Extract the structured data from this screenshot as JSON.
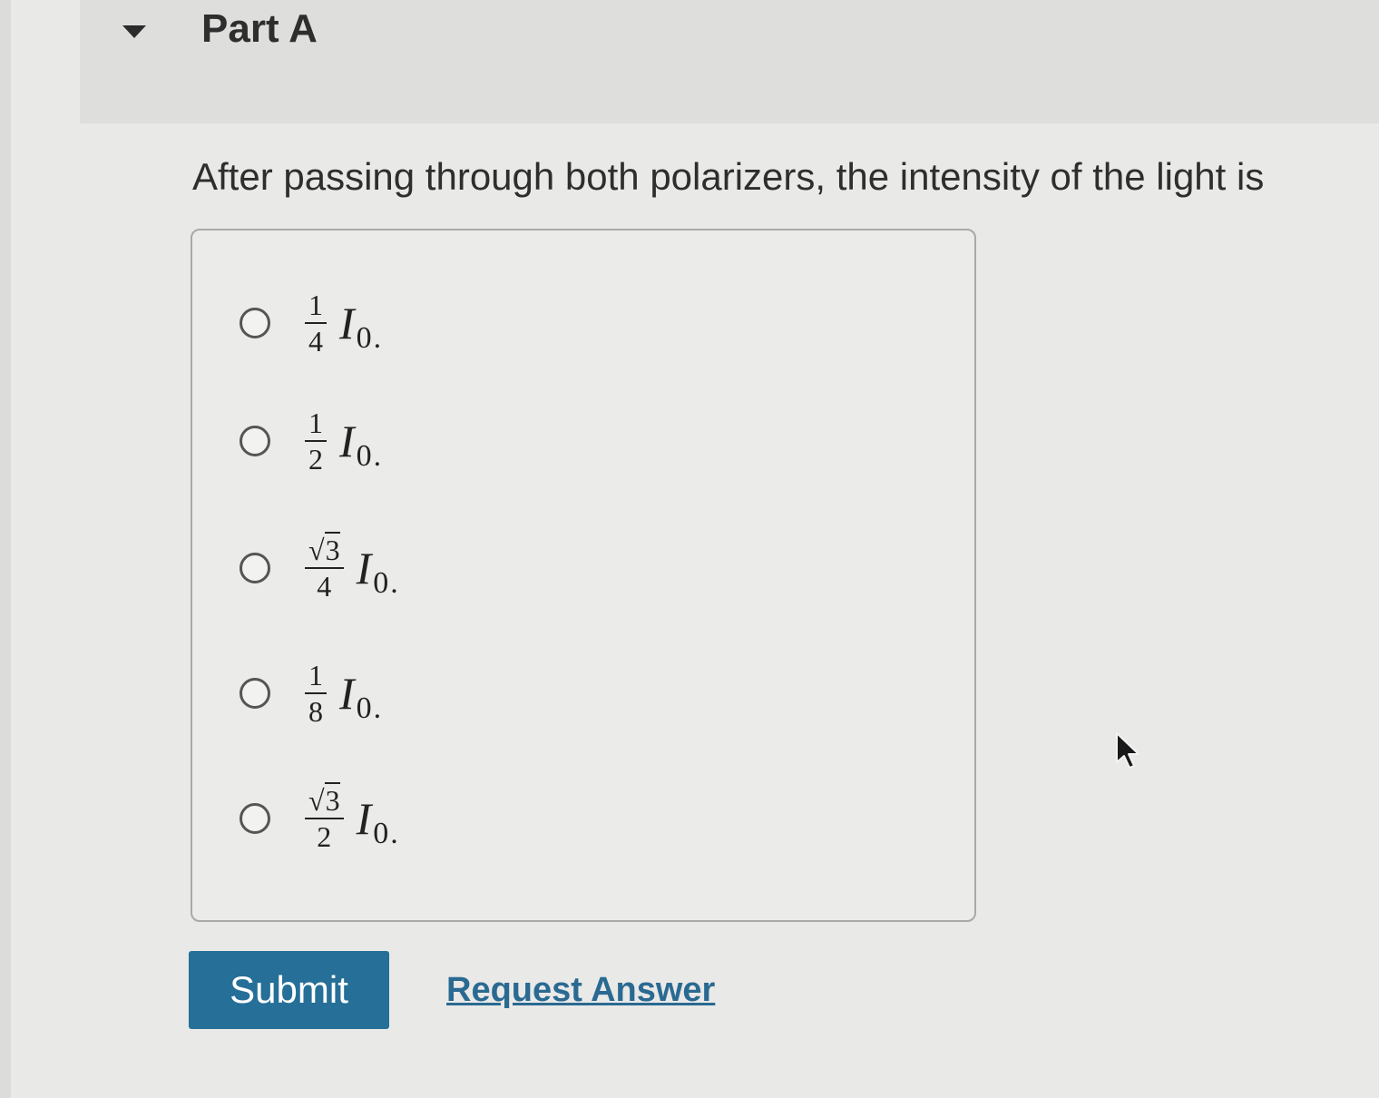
{
  "part": {
    "title": "Part A",
    "toggle_icon": "caret-down-icon"
  },
  "question": {
    "text": "After passing through both polarizers, the intensity of the light is"
  },
  "options": [
    {
      "numerator": "1",
      "denominator": "4",
      "sqrt": false,
      "symbol": "I",
      "subscript": "0",
      "period": "."
    },
    {
      "numerator": "1",
      "denominator": "2",
      "sqrt": false,
      "symbol": "I",
      "subscript": "0",
      "period": "."
    },
    {
      "numerator": "3",
      "denominator": "4",
      "sqrt": true,
      "sqrt_glyph": "√",
      "symbol": "I",
      "subscript": "0",
      "period": "."
    },
    {
      "numerator": "1",
      "denominator": "8",
      "sqrt": false,
      "symbol": "I",
      "subscript": "0",
      "period": "."
    },
    {
      "numerator": "3",
      "denominator": "2",
      "sqrt": true,
      "sqrt_glyph": "√",
      "symbol": "I",
      "subscript": "0",
      "period": "."
    }
  ],
  "actions": {
    "submit_label": "Submit",
    "request_answer_label": "Request Answer"
  },
  "colors": {
    "submit_bg": "#256f98",
    "link": "#2a6a92"
  }
}
